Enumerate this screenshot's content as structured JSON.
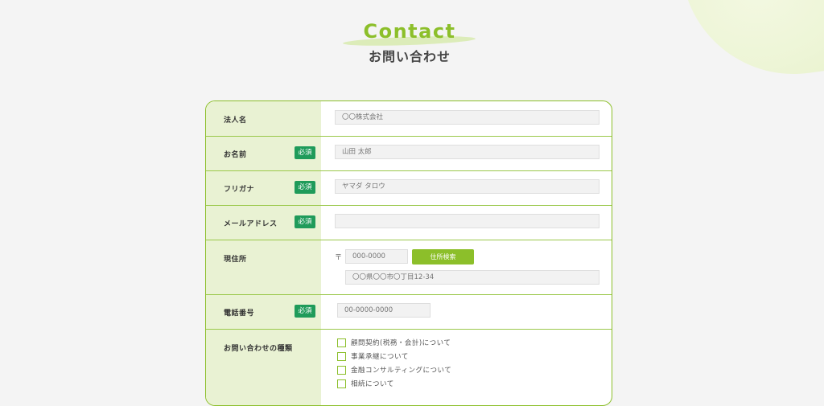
{
  "header": {
    "title_en": "Contact",
    "title_ja": "お問い合わせ"
  },
  "form": {
    "required_label": "必須",
    "company": {
      "label": "法人名",
      "placeholder": "〇〇株式会社"
    },
    "name": {
      "label": "お名前",
      "placeholder": "山田 太郎"
    },
    "furigana": {
      "label": "フリガナ",
      "placeholder": "ヤマダ タロウ"
    },
    "email": {
      "label": "メールアドレス",
      "placeholder": ""
    },
    "address": {
      "label": "現住所",
      "postal_mark": "〒",
      "postal_placeholder": "000-0000",
      "search_button": "住所検索",
      "address_placeholder": "〇〇県〇〇市〇丁目12-34"
    },
    "phone": {
      "label": "電話番号",
      "placeholder": "00-0000-0000"
    },
    "inquiry_type": {
      "label": "お問い合わせの種類",
      "options": [
        "顧問契約(税務・会計)について",
        "事業承継について",
        "金融コンサルティングについて",
        "相続について"
      ]
    }
  },
  "colors": {
    "accent": "#8cbf2a",
    "required_badge": "#1f9b5a",
    "label_bg": "#e9f2d3"
  }
}
